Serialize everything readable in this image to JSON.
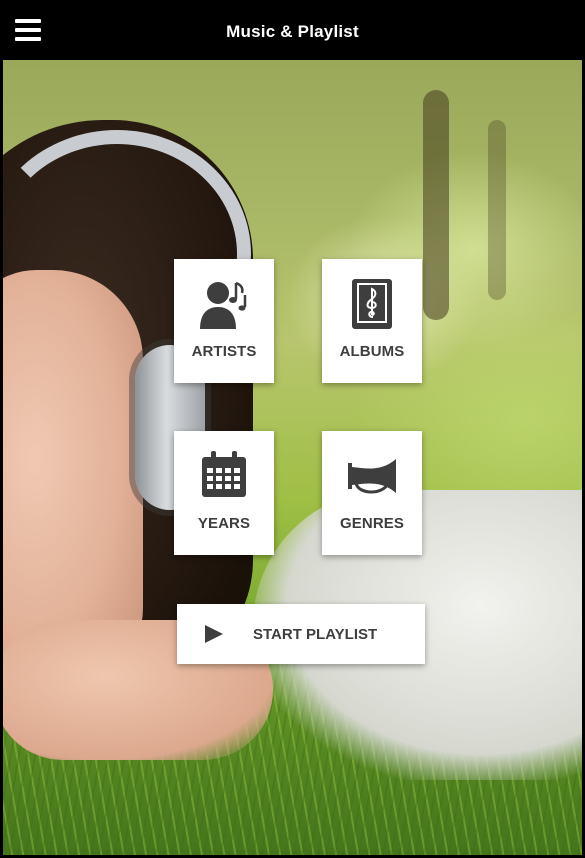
{
  "app": {
    "title": "Music & Playlist",
    "menu_icon": "hamburger-menu-icon"
  },
  "tiles": [
    {
      "key": "artists",
      "label": "ARTISTS",
      "icon": "artist-music-icon"
    },
    {
      "key": "albums",
      "label": "ALBUMS",
      "icon": "album-book-clef-icon"
    },
    {
      "key": "years",
      "label": "YEARS",
      "icon": "calendar-icon"
    },
    {
      "key": "genres",
      "label": "GENRES",
      "icon": "horn-icon"
    }
  ],
  "start_playlist": {
    "label": "START PLAYLIST",
    "icon": "play-icon"
  },
  "colors": {
    "topbar": "#000000",
    "tile_bg": "#ffffff",
    "icon_text": "#3e3e3e"
  }
}
